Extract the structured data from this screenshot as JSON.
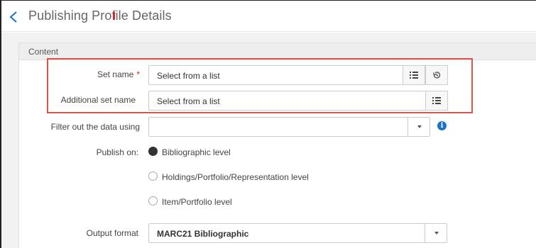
{
  "header": {
    "title": "Publishing Profile Details"
  },
  "content": {
    "section_title": "Content",
    "set_name": {
      "label": "Set name",
      "required_marker": "*",
      "placeholder": "Select from a list"
    },
    "additional_set_name": {
      "label": "Additional set name",
      "placeholder": "Select from a list"
    },
    "filter": {
      "label": "Filter out the data using",
      "value": ""
    },
    "publish_on": {
      "label": "Publish on:",
      "options": [
        {
          "label": "Bibliographic level",
          "selected": true
        },
        {
          "label": "Holdings/Portfolio/Representation level",
          "selected": false
        },
        {
          "label": "Item/Portfolio level",
          "selected": false
        }
      ]
    },
    "output_format": {
      "label": "Output format",
      "value": "MARC21 Bibliographic"
    }
  },
  "colors": {
    "highlight": "#d9534f",
    "required": "#d7262d",
    "info": "#1a73c8"
  }
}
